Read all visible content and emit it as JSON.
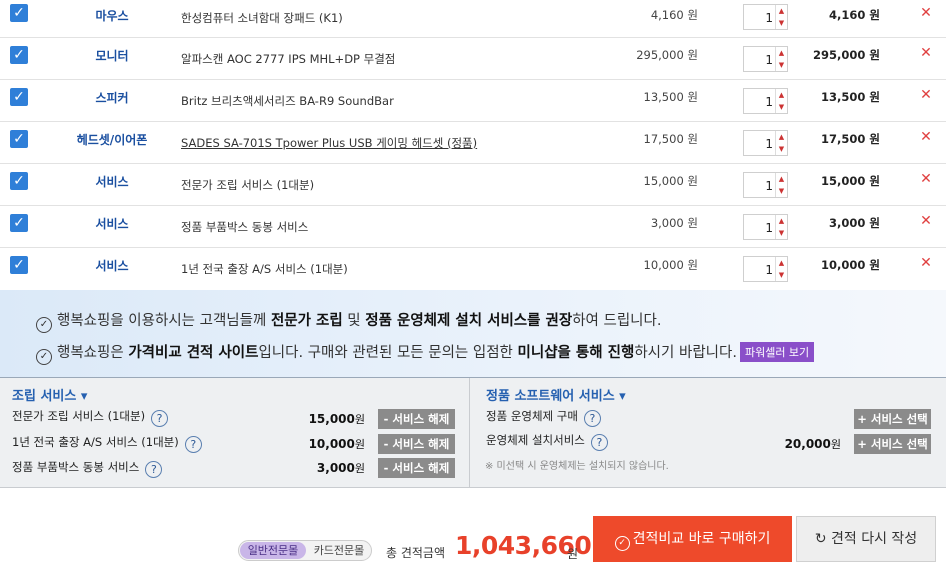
{
  "items": [
    {
      "category": "마우스",
      "name": "한성컴퓨터 소녀함대 장패드 (K1)",
      "unit_price": "4,160 원",
      "qty": "1",
      "total": "4,160 원",
      "underline": false
    },
    {
      "category": "모니터",
      "name": "알파스캔 AOC 2777 IPS MHL+DP 무결점",
      "unit_price": "295,000 원",
      "qty": "1",
      "total": "295,000 원",
      "underline": false
    },
    {
      "category": "스피커",
      "name": "Britz 브리츠액세서리즈 BA-R9 SoundBar",
      "unit_price": "13,500 원",
      "qty": "1",
      "total": "13,500 원",
      "underline": false
    },
    {
      "category": "헤드셋/이어폰",
      "name": "SADES SA-701S Tpower Plus USB 게이밍 헤드셋 (정품)",
      "unit_price": "17,500 원",
      "qty": "1",
      "total": "17,500 원",
      "underline": true
    },
    {
      "category": "서비스",
      "name": "전문가 조립 서비스 (1대분)",
      "unit_price": "15,000 원",
      "qty": "1",
      "total": "15,000 원",
      "underline": false
    },
    {
      "category": "서비스",
      "name": "정품 부품박스 동봉 서비스",
      "unit_price": "3,000 원",
      "qty": "1",
      "total": "3,000 원",
      "underline": false
    },
    {
      "category": "서비스",
      "name": "1년 전국 출장 A/S 서비스 (1대분)",
      "unit_price": "10,000 원",
      "qty": "1",
      "total": "10,000 원",
      "underline": false
    }
  ],
  "icons": {
    "checkbox": "checkmark-icon",
    "delete": "close-icon",
    "spinner_up": "caret-up-icon",
    "spinner_down": "caret-down-icon"
  },
  "notice": {
    "line1": {
      "a": "행복쇼핑을 이용하시는 고객님들께 ",
      "b": "전문가 조립",
      "c": " 및 ",
      "d": "정품 운영체제 설치 서비스를 권장",
      "e": "하여 드립니다."
    },
    "line2": {
      "a": "행복쇼핑은 ",
      "b": "가격비교 견적 사이트",
      "c": "입니다. 구매와 관련된 모든 문의는 입점한 ",
      "d": "미니샵을 통해 진행",
      "e": "하시기 바랍니다.",
      "badge": "파워셀러 보기"
    }
  },
  "assembly": {
    "title": "조립 서비스 ▾",
    "items": [
      {
        "label": "전문가 조립 서비스 (1대분)",
        "price": "15,000",
        "unit": "원",
        "button": "- 서비스 해제"
      },
      {
        "label": "1년 전국 출장 A/S 서비스 (1대분)",
        "price": "10,000",
        "unit": "원",
        "button": "- 서비스 해제"
      },
      {
        "label": "정품 부품박스 동봉 서비스",
        "price": "3,000",
        "unit": "원",
        "button": "- 서비스 해제"
      }
    ]
  },
  "software": {
    "title": "정품 소프트웨어 서비스 ▾",
    "items": [
      {
        "label": "정품 운영체제 구매",
        "price": "",
        "unit": "",
        "button": "+ 서비스 선택"
      },
      {
        "label": "운영체제 설치서비스",
        "price": "20,000",
        "unit": "원",
        "button": "+ 서비스 선택"
      }
    ],
    "note": "※ 미선택 시 운영체제는 설치되지 않습니다."
  },
  "footer": {
    "toggle_on": "일반전문몰",
    "toggle_off": "카드전문몰",
    "total_label": "총 견적금액",
    "total_amount": "1,043,660",
    "total_unit": "원",
    "buy_button": "견적비교 바로 구매하기",
    "rewrite_button": "견적 다시 작성"
  },
  "colors": {
    "accent": "#2f7fd8",
    "buy": "#ee4a2b",
    "total": "#e8412a",
    "badge": "#8a4fc9"
  }
}
